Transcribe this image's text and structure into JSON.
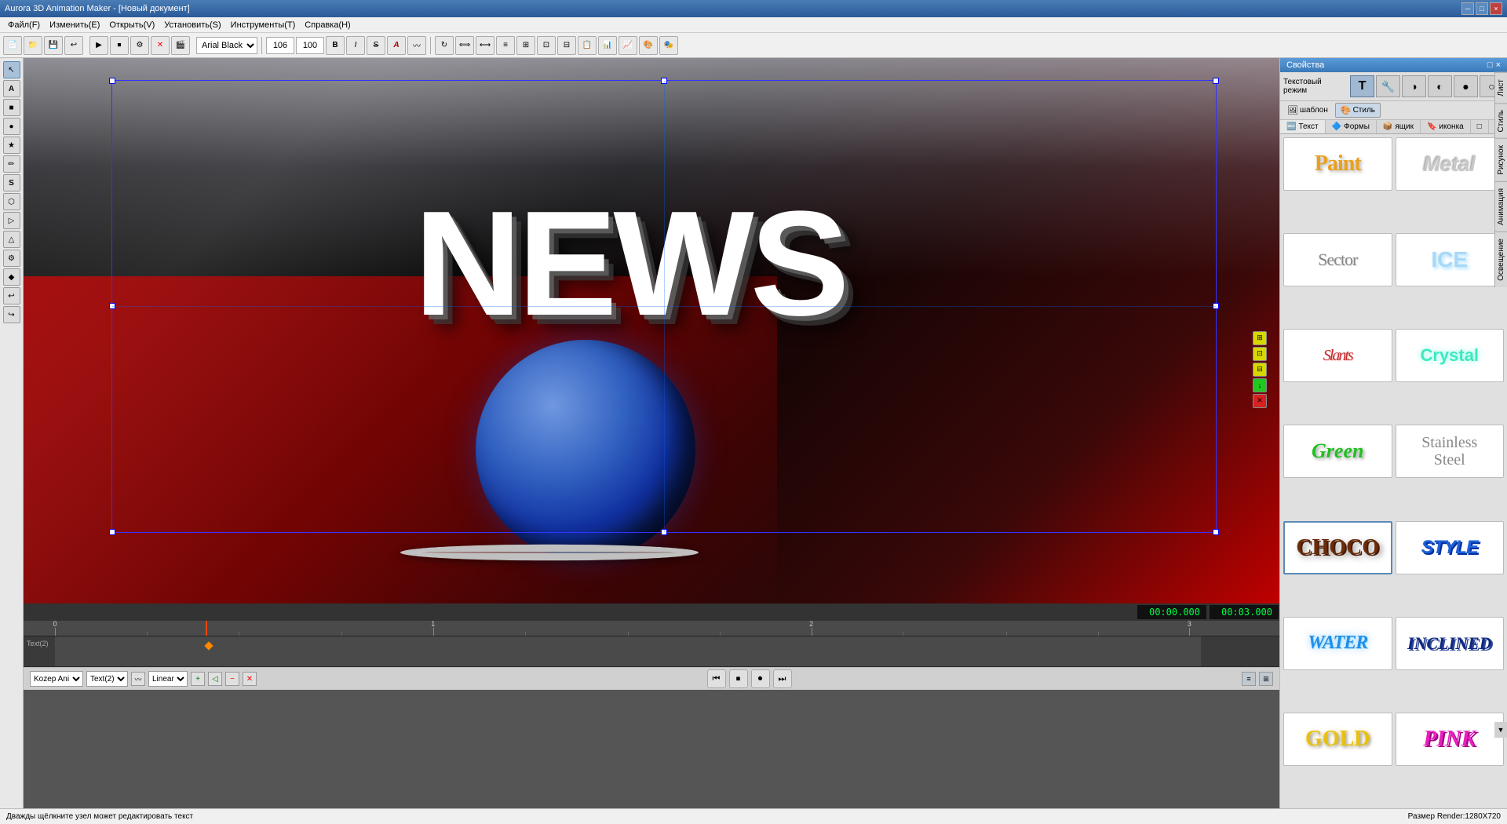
{
  "app": {
    "title": "Aurora 3D Animation Maker - [Новый документ]",
    "window_buttons": [
      "─",
      "□",
      "×"
    ]
  },
  "menubar": {
    "items": [
      "Файл(F)",
      "Изменить(E)",
      "Открыть(V)",
      "Установить(S)",
      "Инструменты(T)",
      "Справка(H)"
    ]
  },
  "toolbar": {
    "font": "Arial Black",
    "size1": "106",
    "size2": "100",
    "bold": "B",
    "italic": "I",
    "strike": "S",
    "special": "A"
  },
  "left_toolbar": {
    "tools": [
      "↖",
      "A",
      "■",
      "●",
      "★",
      "✏",
      "S",
      "⬟",
      "▷",
      "▲",
      "⚙",
      "⬟",
      "↩"
    ]
  },
  "canvas": {
    "news_text": "NEWS",
    "selection_visible": true
  },
  "right_panel": {
    "title": "Свойства",
    "close": "×",
    "pin": "□",
    "text_mode_label": "Текстовый режим",
    "mode_buttons": [
      "T",
      "🔧",
      "◑",
      "◐",
      "●",
      "◯"
    ],
    "sub_tabs": [
      "шаблон",
      "Стиль"
    ],
    "style_tabs": [
      "Текст",
      "Формы",
      "ящик",
      "иконка",
      "□"
    ],
    "styles": [
      {
        "id": "paint",
        "label": "Paint",
        "class": "style-paint"
      },
      {
        "id": "metal",
        "label": "Metal",
        "class": "style-metal"
      },
      {
        "id": "sector",
        "label": "Sector",
        "class": "style-sector"
      },
      {
        "id": "ice",
        "label": "ICE",
        "class": "style-ice"
      },
      {
        "id": "slants",
        "label": "Slants",
        "class": "style-slants"
      },
      {
        "id": "crystal",
        "label": "Crystal",
        "class": "style-crystal"
      },
      {
        "id": "green",
        "label": "Green",
        "class": "style-green"
      },
      {
        "id": "stainless",
        "label": "Stainless Steel",
        "class": "style-stainless"
      },
      {
        "id": "choco",
        "label": "CHOCO",
        "class": "style-choco"
      },
      {
        "id": "style",
        "label": "STYLE",
        "class": "style-style"
      },
      {
        "id": "water",
        "label": "WATER",
        "class": "style-water"
      },
      {
        "id": "inclined",
        "label": "INCLINED",
        "class": "style-inclined"
      },
      {
        "id": "gold",
        "label": "GOLD",
        "class": "style-gold"
      },
      {
        "id": "pink",
        "label": "PINK",
        "class": "style-pink"
      }
    ],
    "vtabs": [
      "Лист",
      "Стиль",
      "Рисунок",
      "Анимация",
      "Освещение"
    ]
  },
  "timeline": {
    "time1": "00:00.000",
    "time2": "00:03.000",
    "marks": [
      "1",
      "2",
      "3"
    ],
    "track_label": "Text(2)",
    "interpolation": "Linear"
  },
  "statusbar": {
    "hint": "Дважды щёлкните узел может редактировать текст",
    "render_size": "Размер Render:1280X720"
  },
  "bottom_controls": {
    "layer_select": "Kozep Ani",
    "object_select": "Text(2)",
    "interp_select": "Linear",
    "play_buttons": [
      "⏮",
      "⏹",
      "⏺",
      "⏭"
    ]
  }
}
